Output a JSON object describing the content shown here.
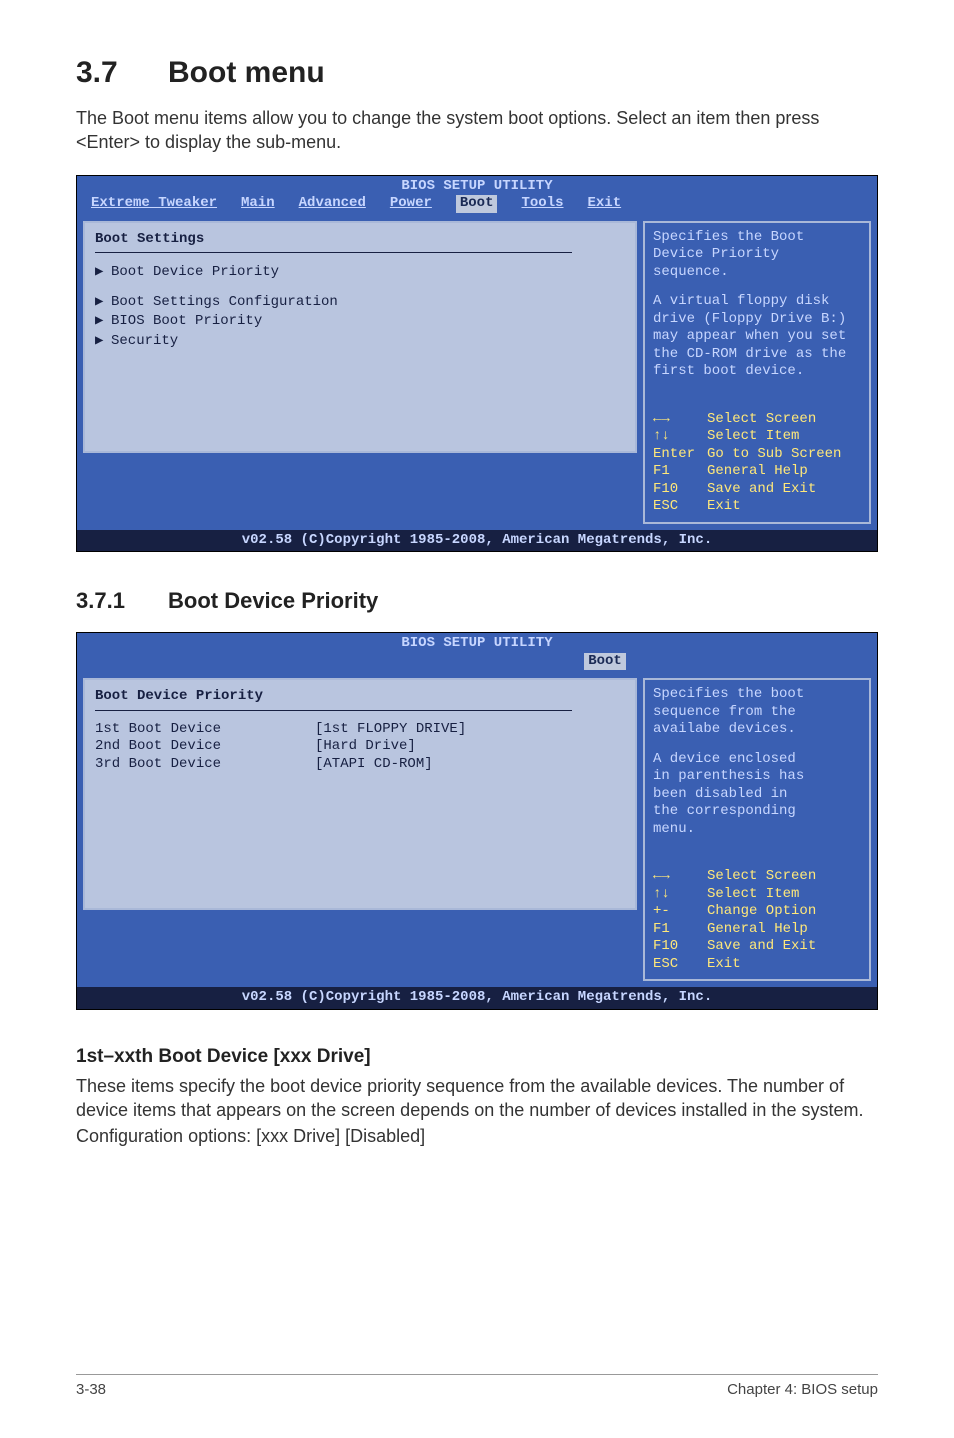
{
  "section": {
    "number": "3.7",
    "title": "Boot menu"
  },
  "intro": "The Boot menu items allow you to change the system boot options. Select an item then press <Enter> to display the sub-menu.",
  "bios1": {
    "title": "BIOS SETUP UTILITY",
    "menu": [
      "Extreme Tweaker",
      "Main",
      "Advanced",
      "Power",
      "Boot",
      "Tools",
      "Exit"
    ],
    "active_menu": "Boot",
    "panel_heading": "Boot Settings",
    "items": [
      "Boot Device Priority",
      "Boot Settings Configuration",
      "BIOS Boot Priority",
      "Security"
    ],
    "help": [
      "Specifies the Boot",
      "Device Priority",
      "sequence.",
      "",
      "A virtual floppy disk",
      "drive (Floppy Drive B:)",
      "may appear when you set",
      "the CD-ROM drive as the",
      "first boot device."
    ],
    "keys": [
      {
        "icon": "←→",
        "label": "Select Screen"
      },
      {
        "icon": "↑↓",
        "label": "Select Item"
      },
      {
        "icon": "Enter",
        "label": "Go to Sub Screen"
      },
      {
        "icon": "F1",
        "label": "General Help"
      },
      {
        "icon": "F10",
        "label": "Save and Exit"
      },
      {
        "icon": "ESC",
        "label": "Exit"
      }
    ],
    "footer": "v02.58 (C)Copyright 1985-2008, American Megatrends, Inc."
  },
  "subsection": {
    "number": "3.7.1",
    "title": "Boot Device Priority"
  },
  "bios2": {
    "title": "BIOS SETUP UTILITY",
    "active_menu": "Boot",
    "panel_heading": "Boot Device Priority",
    "rows": [
      {
        "k": "1st Boot Device",
        "v": "[1st FLOPPY DRIVE]"
      },
      {
        "k": "2nd Boot Device",
        "v": "[Hard Drive]"
      },
      {
        "k": "3rd Boot Device",
        "v": "[ATAPI CD-ROM]"
      }
    ],
    "help": [
      "Specifies the boot",
      "sequence from the",
      "availabe devices.",
      "",
      "A device enclosed",
      "in parenthesis has",
      "been disabled in",
      "the corresponding",
      "menu."
    ],
    "keys": [
      {
        "icon": "←→",
        "label": "Select Screen"
      },
      {
        "icon": "↑↓",
        "label": "Select Item"
      },
      {
        "icon": "+-",
        "label": "Change Option"
      },
      {
        "icon": "F1",
        "label": "General Help"
      },
      {
        "icon": "F10",
        "label": "Save and Exit"
      },
      {
        "icon": "ESC",
        "label": "Exit"
      }
    ],
    "footer": "v02.58 (C)Copyright 1985-2008, American Megatrends, Inc."
  },
  "para": {
    "heading": "1st–xxth Boot Device [xxx Drive]",
    "body1": "These items specify the boot device priority sequence from the available devices. The number of device items that appears on the screen depends on the number of devices installed in the system.",
    "body2": "Configuration options: [xxx Drive] [Disabled]"
  },
  "footer": {
    "left": "3-38",
    "right": "Chapter 4: BIOS setup"
  }
}
